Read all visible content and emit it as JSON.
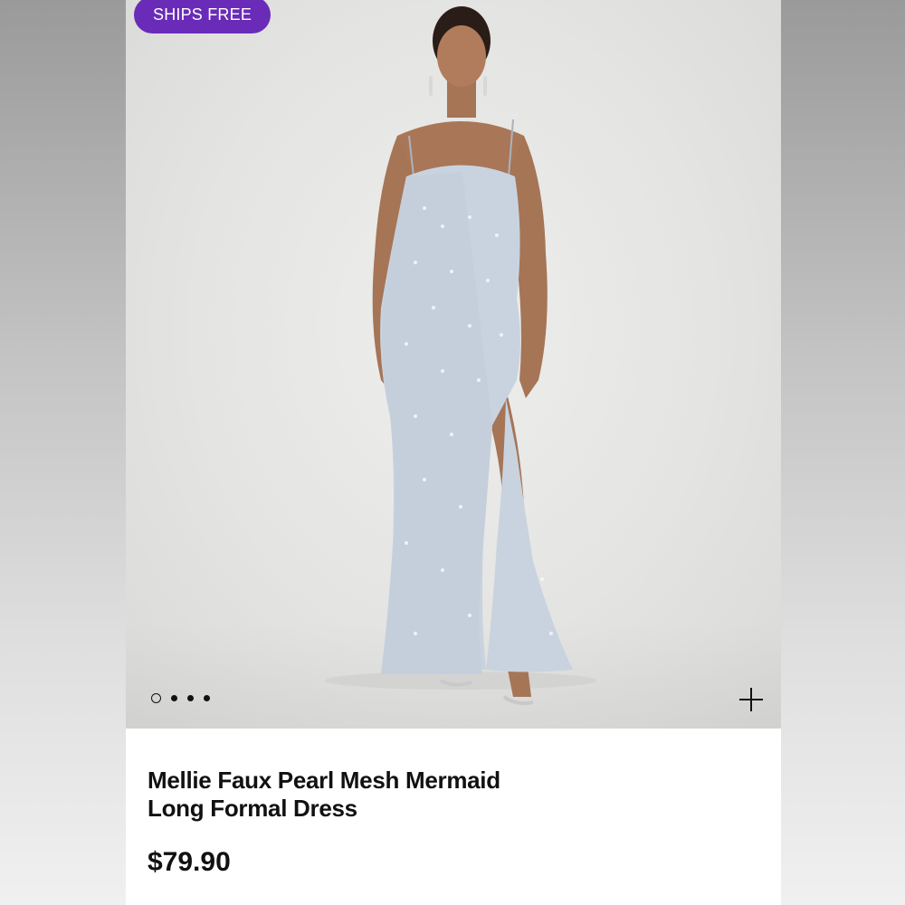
{
  "badge": {
    "label": "SHIPS FREE",
    "color": "#6a2bb8"
  },
  "gallery": {
    "image_count": 4,
    "active_index": 0
  },
  "product": {
    "title_line1": "Mellie Faux Pearl Mesh Mermaid",
    "title_line2": "Long Formal Dress",
    "price": "$79.90"
  },
  "icons": {
    "expand": "plus-icon"
  },
  "colors": {
    "dress": "#c9d3df",
    "background": "#e6e6e4",
    "text": "#111111"
  }
}
